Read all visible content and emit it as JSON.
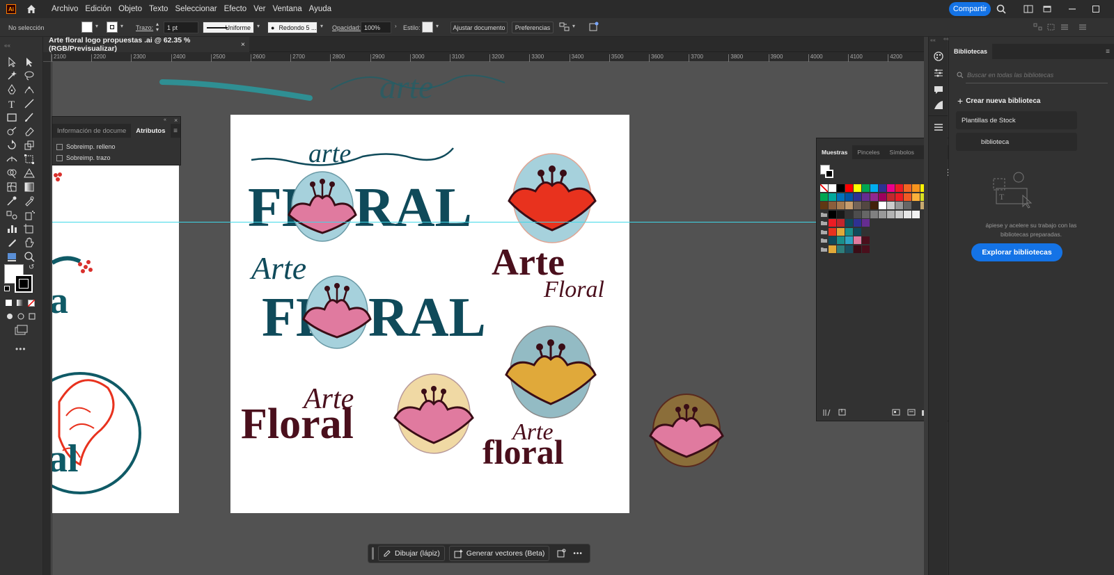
{
  "app": {
    "logo_text": "Ai",
    "menu": [
      "Archivo",
      "Edición",
      "Objeto",
      "Texto",
      "Seleccionar",
      "Efecto",
      "Ver",
      "Ventana",
      "Ayuda"
    ],
    "share_label": "Compartir"
  },
  "control_bar": {
    "selection_label": "No selección",
    "stroke_label": "Trazo:",
    "stroke_weight": "1 pt",
    "profile": "Uniforme",
    "brush": "Redondo 5 ...",
    "opacity_label": "Opacidad:",
    "opacity_value": "100%",
    "style_label": "Estilo:",
    "fit_document": "Ajustar documento",
    "preferences": "Preferencias"
  },
  "document": {
    "tab_title": "Arte floral logo propuestas .ai @ 62.35 % (RGB/Previsualizar)",
    "close": "×"
  },
  "ruler": {
    "h_ticks": [
      "2100",
      "2200",
      "2300",
      "2400",
      "2500",
      "2600",
      "2700",
      "2800",
      "2900",
      "3000",
      "3100",
      "3200",
      "3300",
      "3400",
      "3500",
      "3600",
      "3700",
      "3800",
      "3900",
      "4000",
      "4100",
      "4200"
    ]
  },
  "attributes_panel": {
    "tab_info": "Información de docume",
    "tab_attributes": "Atributos",
    "overprint_fill": "Sobreimp. relleno",
    "overprint_stroke": "Sobreimp. trazo"
  },
  "artwork": {
    "logo1_top": "arte",
    "logo1_main_left": "FL",
    "logo1_main_right": "RAL",
    "logo2_script": "Arte",
    "logo2_main_left": "FL",
    "logo2_main_right": "RAL",
    "logo3_top": "Arte",
    "logo3_bottom": "Floral",
    "logo4_top": "Arte",
    "logo4_bottom": "Floral",
    "logo5_top": "Arte",
    "logo5_bottom": "floral",
    "bg_script": "arte",
    "teal": "#0f4a5a",
    "maroon": "#4a0f1c",
    "pink": "#e07a9f",
    "red": "#e8321e",
    "gold": "#e0a93a",
    "light_blue": "#a6d1dc"
  },
  "swatches_panel": {
    "tabs": [
      "Muestras",
      "Pinceles",
      "Símbolos"
    ]
  },
  "libraries_panel": {
    "title": "Bibliotecas",
    "search_placeholder": "Buscar en todas las bibliotecas",
    "create_new": "Crear nueva biblioteca",
    "stock_templates": "Plantillas de Stock",
    "library_item": "biblioteca",
    "promo_text_1": "ápiese y acelere su trabajo con las",
    "promo_text_2": "bibliotecas preparadas.",
    "explore": "Explorar bibliotecas"
  },
  "context_bar": {
    "draw_label": "Dibujar (lápiz)",
    "vectors_label": "Generar vectores (Beta)",
    "more": "•••"
  }
}
